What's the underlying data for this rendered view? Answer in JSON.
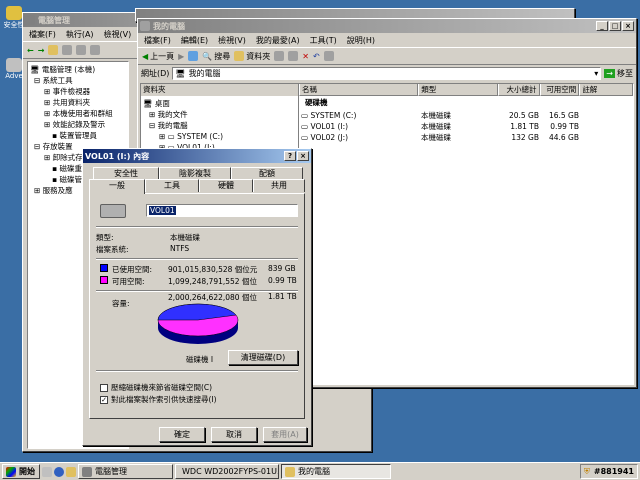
{
  "colors": {
    "desktop": "#3a6ea5",
    "title_active": "#0a246a",
    "used": "#0000ff",
    "free": "#ff00ff",
    "pie_used": "#3030ff",
    "pie_free": "#ff30ff"
  },
  "desktop": {
    "icon1_label": "安全性",
    "icon2_label": "Adve"
  },
  "comp_mgmt": {
    "title": "電腦管理",
    "menu": [
      "檔案(F)",
      "執行(A)",
      "檢視(V)"
    ],
    "tree": [
      "電腦管理 (本機)",
      "系統工具",
      "事件檢視器",
      "共用資料夾",
      "本機使用者和群組",
      "效能記錄及警示",
      "裝置管理員",
      "存放裝置",
      "卸除式存放裝置",
      "磁碟重",
      "磁碟管",
      "服務及應"
    ]
  },
  "task_window": {
    "title_partial": ""
  },
  "explorer": {
    "title": "我的電腦",
    "menu": [
      "檔案(F)",
      "編輯(E)",
      "檢視(V)",
      "我的最愛(A)",
      "工具(T)",
      "說明(H)"
    ],
    "toolbar": {
      "back": "上一頁",
      "search": "搜尋",
      "folders": "資料夾"
    },
    "address_label": "網址(D)",
    "address_value": "我的電腦",
    "go_label": "移至",
    "folder_pane_title": "資料夾",
    "tree": [
      "桌面",
      "我的文件",
      "我的電腦",
      "SYSTEM (C:)",
      "VOL01 (I:)"
    ],
    "columns": [
      "名稱",
      "類型",
      "大小總計",
      "可用空間",
      "註解"
    ],
    "group_header": "硬碟機",
    "rows": [
      {
        "name": "SYSTEM (C:)",
        "type": "本機磁碟",
        "total": "20.5 GB",
        "free": "16.5 GB"
      },
      {
        "name": "VOL01 (I:)",
        "type": "本機磁碟",
        "total": "1.81 TB",
        "free": "0.99 TB"
      },
      {
        "name": "VOL02 (J:)",
        "type": "本機磁碟",
        "total": "132 GB",
        "free": "44.6 GB"
      }
    ]
  },
  "props": {
    "title": "VOL01 (I:) 內容",
    "tabs_back": [
      "安全性",
      "陰影複製",
      "配額"
    ],
    "tabs_front": [
      "一般",
      "工具",
      "硬體",
      "共用"
    ],
    "volume_name": "VOL01",
    "type_label": "類型:",
    "type_value": "本機磁碟",
    "fs_label": "檔案系統:",
    "fs_value": "NTFS",
    "used_label": "已使用空間:",
    "used_bytes": "901,015,830,528 個位元",
    "used_size": "839 GB",
    "free_label": "可用空間:",
    "free_bytes": "1,099,248,791,552 個位",
    "free_size": "0.99 TB",
    "cap_label": "容量:",
    "cap_bytes": "2,000,264,622,080 個位",
    "cap_size": "1.81 TB",
    "drive_label": "磁碟機 I",
    "cleanup": "清理磁碟(D)",
    "compress": "壓縮磁碟機來節省磁碟空間(C)",
    "index": "對此檔案製作索引供快速搜尋(I)",
    "ok": "確定",
    "cancel": "取消",
    "apply": "套用(A)",
    "used_fraction": 0.45
  },
  "taskbar": {
    "start": "開始",
    "tasks": [
      "電腦管理",
      "WDC WD2002FYPS-01U...",
      "我的電腦"
    ],
    "watermark": "#881941"
  }
}
